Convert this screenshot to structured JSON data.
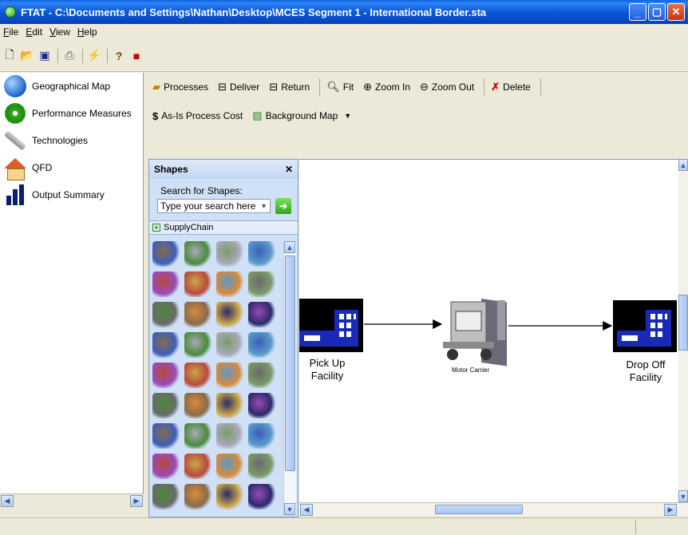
{
  "window": {
    "title": "FTAT - C:\\Documents and Settings\\Nathan\\Desktop\\MCES Segment 1 - International Border.sta"
  },
  "menu": [
    "File",
    "Edit",
    "View",
    "Help"
  ],
  "toolbar": {
    "icons": [
      "new-file-icon",
      "open-folder-icon",
      "save-icon",
      "print-icon",
      "lightning-icon",
      "help-icon",
      "stop-icon"
    ]
  },
  "nav": [
    {
      "label": "Geographical Map",
      "icon": "globe-icon"
    },
    {
      "label": "Performance Measures",
      "icon": "gear-icon"
    },
    {
      "label": "Technologies",
      "icon": "wrench-icon"
    },
    {
      "label": "QFD",
      "icon": "house-icon"
    },
    {
      "label": "Output Summary",
      "icon": "bar-chart-icon"
    }
  ],
  "ribbon": {
    "row1": [
      {
        "label": "Processes",
        "icon": "processes-icon"
      },
      {
        "label": "Deliver",
        "icon": "deliver-icon"
      },
      {
        "label": "Return",
        "icon": "return-icon"
      },
      {
        "label": "Fit",
        "icon": "magnifier-icon"
      },
      {
        "label": "Zoom In",
        "icon": "zoom-in-icon"
      },
      {
        "label": "Zoom Out",
        "icon": "zoom-out-icon"
      },
      {
        "label": "Delete",
        "icon": "delete-x-icon"
      }
    ],
    "row2": [
      {
        "label": "As-Is Process Cost",
        "icon": "dollar-icon"
      },
      {
        "label": "Background Map",
        "icon": "map-icon"
      }
    ]
  },
  "shapes": {
    "title": "Shapes",
    "search_label": "Search for Shapes:",
    "search_value": "Type your search here",
    "category": "SupplyChain"
  },
  "diagram": {
    "nodes": [
      {
        "label_line1": "Pick Up",
        "label_line2": "Facility"
      },
      {
        "label": "Motor Carrier"
      },
      {
        "label_line1": "Drop Off",
        "label_line2": "Facility"
      }
    ]
  },
  "colors": {
    "title_bar": "#0a58d8",
    "facility": "#000000",
    "facility_window": "#1a2ab8"
  }
}
